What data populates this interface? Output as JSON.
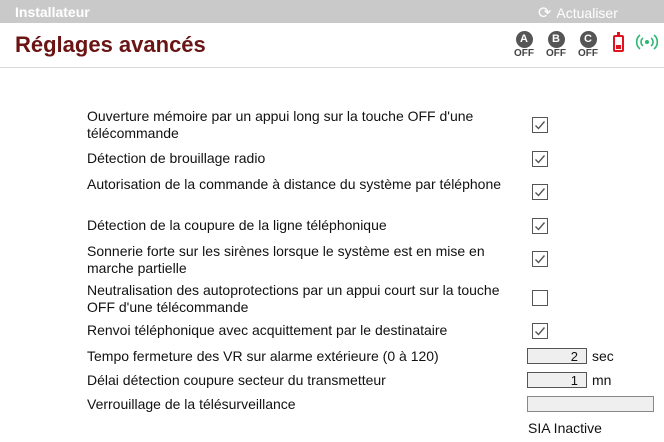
{
  "topbar": {
    "title": "Installateur",
    "refresh_label": "Actualiser",
    "refresh_icon": "refresh-icon"
  },
  "page": {
    "title": "Réglages avancés"
  },
  "status": {
    "groups": [
      {
        "letter": "A",
        "state": "OFF"
      },
      {
        "letter": "B",
        "state": "OFF"
      },
      {
        "letter": "C",
        "state": "OFF"
      }
    ],
    "battery_icon": "battery-icon",
    "battery_color": "#e0141e",
    "signal_icon": "signal-icon",
    "signal_color": "#2bb673"
  },
  "options": [
    {
      "label": "Ouverture mémoire par un appui long sur la touche OFF d'une télécommande",
      "checked": true
    },
    {
      "label": "Détection de brouillage radio",
      "checked": true
    },
    {
      "label": "Autorisation de la commande à distance du système par téléphone",
      "checked": true
    },
    {
      "label": "Détection de la coupure de la ligne téléphonique",
      "checked": true
    },
    {
      "label": "Sonnerie forte sur les sirènes lorsque le système est en mise en marche partielle",
      "checked": true
    },
    {
      "label": "Neutralisation des autoprotections par un appui court sur la touche OFF d'une télécommande",
      "checked": false
    },
    {
      "label": "Renvoi téléphonique avec acquittement par le destinataire",
      "checked": true
    }
  ],
  "fields": {
    "tempo": {
      "label": "Tempo fermeture des VR sur alarme extérieure (0 à 120)",
      "value": "2",
      "unit": "sec"
    },
    "delai": {
      "label": "Délai détection coupure secteur du transmetteur",
      "value": "1",
      "unit": "mn"
    },
    "verrou": {
      "label": "Verrouillage de la télésurveillance",
      "value": ""
    }
  },
  "sia_status": "SIA Inactive",
  "colors": {
    "title": "#6b1414",
    "topbar": "#c9c9c9"
  }
}
